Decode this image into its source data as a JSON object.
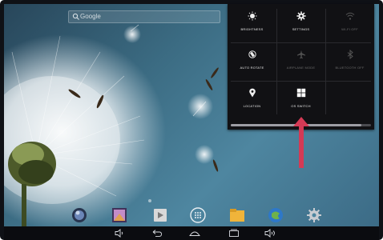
{
  "search": {
    "label": "Google"
  },
  "quick_settings": {
    "tiles": [
      {
        "label": "BRIGHTNESS",
        "icon": "brightness-icon",
        "dim": false
      },
      {
        "label": "SETTINGS",
        "icon": "gear-icon",
        "dim": false
      },
      {
        "label": "WI-FI OFF",
        "icon": "wifi-icon",
        "dim": true
      },
      {
        "label": "AUTO ROTATE",
        "icon": "rotate-icon",
        "dim": false
      },
      {
        "label": "AIRPLANE MODE",
        "icon": "airplane-icon",
        "dim": true
      },
      {
        "label": "BLUETOOTH OFF",
        "icon": "bluetooth-icon",
        "dim": true
      },
      {
        "label": "LOCATION",
        "icon": "location-icon",
        "dim": false
      },
      {
        "label": "OS SWITCH",
        "icon": "windows-icon",
        "dim": false
      }
    ],
    "brightness_level": 0.93
  },
  "dock": {
    "apps": [
      {
        "name": "browser-app-icon",
        "color": "#5a6f95"
      },
      {
        "name": "gallery-app-icon",
        "color": "#c38cc8"
      },
      {
        "name": "play-store-app-icon",
        "color": "#d9d9d9"
      },
      {
        "name": "app-drawer-icon",
        "color": "#ffffff"
      },
      {
        "name": "file-manager-app-icon",
        "color": "#f0b43a"
      },
      {
        "name": "internet-app-icon",
        "color": "#2e78c8"
      },
      {
        "name": "settings-app-icon",
        "color": "#c8ccd2"
      }
    ]
  },
  "navbar": {
    "buttons": [
      "volume-down-icon",
      "back-icon",
      "home-icon",
      "recent-apps-icon",
      "volume-up-icon"
    ]
  },
  "colors": {
    "annotation_arrow": "#d43a55",
    "panel_background": "#111114"
  }
}
